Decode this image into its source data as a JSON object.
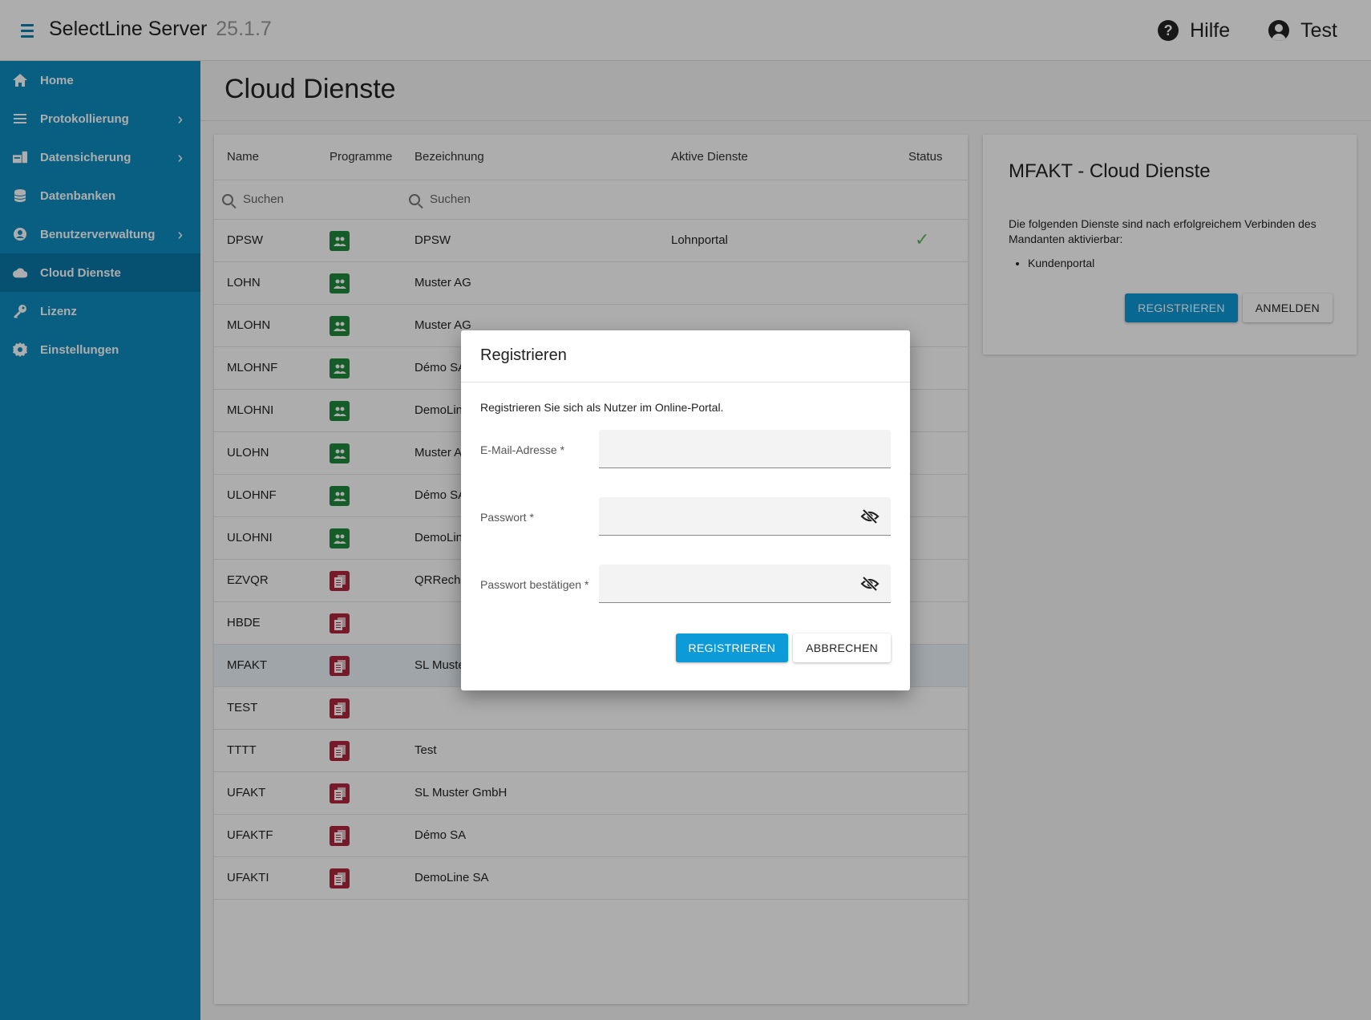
{
  "app": {
    "title": "SelectLine Server",
    "version": "25.1.7",
    "help_label": "Hilfe",
    "user_label": "Test"
  },
  "sidebar": {
    "items": [
      {
        "label": "Home",
        "icon": "home-icon",
        "has_children": false
      },
      {
        "label": "Protokollierung",
        "icon": "list-icon",
        "has_children": true
      },
      {
        "label": "Datensicherung",
        "icon": "backup-icon",
        "has_children": true
      },
      {
        "label": "Datenbanken",
        "icon": "database-icon",
        "has_children": false
      },
      {
        "label": "Benutzerverwaltung",
        "icon": "account-icon",
        "has_children": true
      },
      {
        "label": "Cloud Dienste",
        "icon": "cloud-icon",
        "has_children": false,
        "active": true
      },
      {
        "label": "Lizenz",
        "icon": "key-icon",
        "has_children": false
      },
      {
        "label": "Einstellungen",
        "icon": "gear-icon",
        "has_children": false
      }
    ]
  },
  "page": {
    "title": "Cloud Dienste"
  },
  "table": {
    "headers": {
      "name": "Name",
      "programme": "Programme",
      "bezeichnung": "Bezeichnung",
      "aktive_dienste": "Aktive Dienste",
      "status": "Status"
    },
    "search_placeholder_name": "Suchen",
    "search_placeholder_bezeichnung": "Suchen",
    "rows": [
      {
        "name": "DPSW",
        "program": "lohn",
        "bezeichnung": "DPSW",
        "dienste": "Lohnportal",
        "status": "ok"
      },
      {
        "name": "LOHN",
        "program": "lohn",
        "bezeichnung": "Muster AG",
        "dienste": "",
        "status": ""
      },
      {
        "name": "MLOHN",
        "program": "lohn",
        "bezeichnung": "Muster AG",
        "dienste": "",
        "status": ""
      },
      {
        "name": "MLOHNF",
        "program": "lohn",
        "bezeichnung": "Démo SA",
        "dienste": "",
        "status": ""
      },
      {
        "name": "MLOHNI",
        "program": "lohn",
        "bezeichnung": "DemoLine",
        "dienste": "",
        "status": ""
      },
      {
        "name": "ULOHN",
        "program": "lohn",
        "bezeichnung": "Muster A",
        "dienste": "",
        "status": ""
      },
      {
        "name": "ULOHNF",
        "program": "lohn",
        "bezeichnung": "Démo SA",
        "dienste": "",
        "status": ""
      },
      {
        "name": "ULOHNI",
        "program": "lohn",
        "bezeichnung": "DemoLine",
        "dienste": "",
        "status": ""
      },
      {
        "name": "EZVQR",
        "program": "fakt",
        "bezeichnung": "QRRechnu",
        "dienste": "",
        "status": ""
      },
      {
        "name": "HBDE",
        "program": "fakt",
        "bezeichnung": "",
        "dienste": "",
        "status": ""
      },
      {
        "name": "MFAKT",
        "program": "fakt",
        "bezeichnung": "SL Muste",
        "dienste": "",
        "status": "",
        "selected": true
      },
      {
        "name": "TEST",
        "program": "fakt",
        "bezeichnung": "",
        "dienste": "",
        "status": ""
      },
      {
        "name": "TTTT",
        "program": "fakt",
        "bezeichnung": "Test",
        "dienste": "",
        "status": ""
      },
      {
        "name": "UFAKT",
        "program": "fakt",
        "bezeichnung": "SL Muster GmbH",
        "dienste": "",
        "status": ""
      },
      {
        "name": "UFAKTF",
        "program": "fakt",
        "bezeichnung": "Démo SA",
        "dienste": "",
        "status": ""
      },
      {
        "name": "UFAKTI",
        "program": "fakt",
        "bezeichnung": "DemoLine SA",
        "dienste": "",
        "status": ""
      }
    ]
  },
  "detail": {
    "title": "MFAKT - Cloud Dienste",
    "text": "Die folgenden Dienste sind nach erfolgreichem Verbinden des Mandanten aktivierbar:",
    "services": [
      "Kundenportal"
    ],
    "register_label": "REGISTRIEREN",
    "login_label": "ANMELDEN"
  },
  "dialog": {
    "title": "Registrieren",
    "description": "Registrieren Sie sich als Nutzer im Online-Portal.",
    "email_label": "E-Mail-Adresse *",
    "password_label": "Passwort *",
    "password_confirm_label": "Passwort bestätigen *",
    "email_value": "",
    "password_value": "",
    "password_confirm_value": "",
    "submit_label": "REGISTRIEREN",
    "cancel_label": "ABBRECHEN"
  },
  "colors": {
    "sidebar": "#0d8cc0",
    "sidebar_active": "#0a78a8",
    "primary": "#0d9ad8",
    "program_lohn": "#1e8a3c",
    "program_fakt": "#b1253d",
    "status_ok": "#5cb85c"
  }
}
